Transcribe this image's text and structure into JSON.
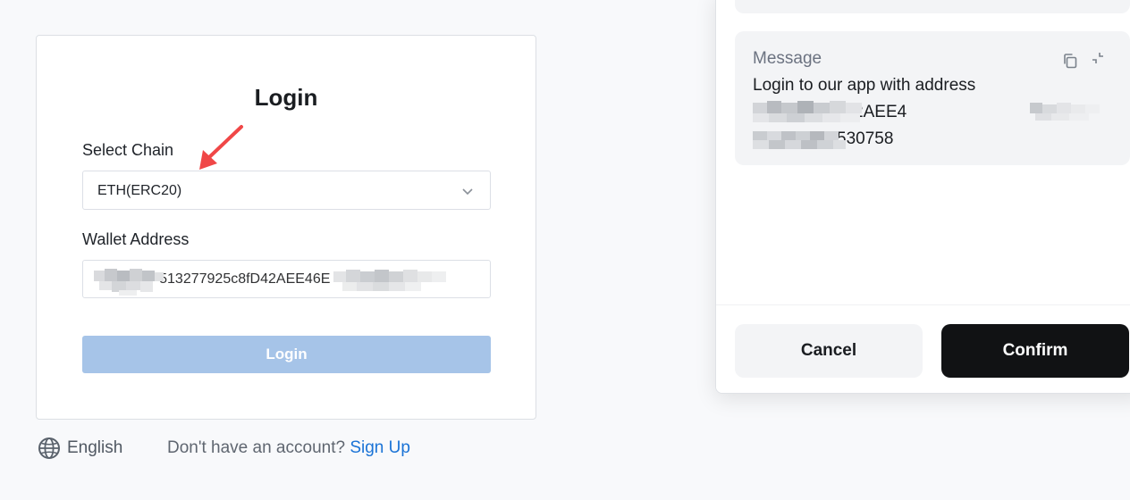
{
  "login": {
    "title": "Login",
    "chain_label": "Select Chain",
    "chain_value": "ETH(ERC20)",
    "wallet_label": "Wallet Address",
    "wallet_value": "                513277925c8fD42AEE46E",
    "login_button": "Login"
  },
  "footer": {
    "language": "English",
    "no_account_text": "Don't have an account?",
    "signup_link": "Sign Up"
  },
  "sign_dialog": {
    "message_title": "Message",
    "message_line1": "Login to our app with address",
    "message_line2": "               277925c8fD42AEE4",
    "message_line3": "              and nonce 530758",
    "cancel_button": "Cancel",
    "confirm_button": "Confirm"
  },
  "icons": {
    "chevron": "chevron-down-icon",
    "globe": "globe-icon",
    "copy": "copy-icon",
    "collapse": "collapse-icon"
  },
  "colors": {
    "login_button_disabled": "#a6c4e8",
    "link": "#1a73d6",
    "confirm_button": "#111214",
    "annotation_arrow": "#f04747"
  }
}
